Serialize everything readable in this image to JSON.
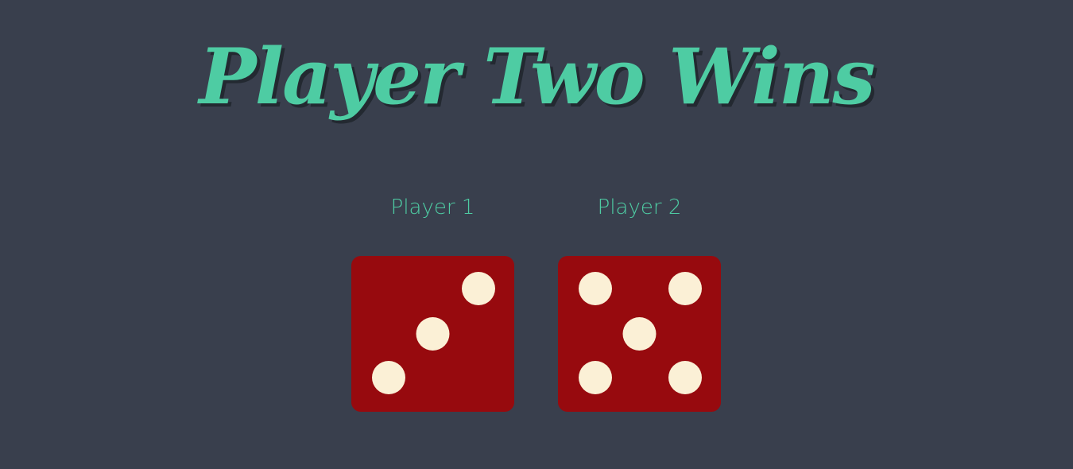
{
  "title": "Player Two Wins",
  "colors": {
    "background": "#393f4d",
    "accent": "#4ecca3",
    "die_face": "#970a0e",
    "pip": "#fbf0d6"
  },
  "players": [
    {
      "label": "Player 1",
      "die_value": 3
    },
    {
      "label": "Player 2",
      "die_value": 5
    }
  ]
}
